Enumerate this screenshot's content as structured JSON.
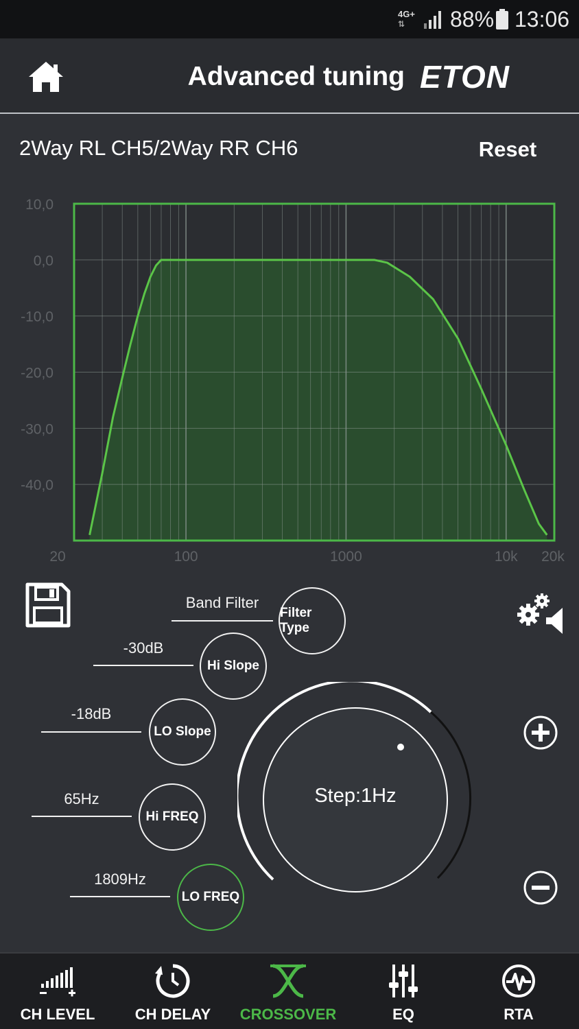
{
  "status_bar": {
    "network": "4G+",
    "battery": "88%",
    "time": "13:06"
  },
  "header": {
    "title": "Advanced tuning",
    "brand": "ETON"
  },
  "channel": {
    "title": "2Way RL CH5/2Way RR CH6",
    "reset_label": "Reset"
  },
  "chart_data": {
    "type": "area",
    "y_axis": {
      "range": [
        -50,
        10
      ],
      "tick_labels": [
        "10,0",
        "0,0",
        "-10,0",
        "-20,0",
        "-30,0",
        "-40,0"
      ],
      "ticks": [
        10,
        0,
        -10,
        -20,
        -30,
        -40
      ]
    },
    "x_axis": {
      "scale": "log",
      "range": [
        20,
        20000
      ],
      "tick_labels": [
        "20",
        "100",
        "1000",
        "10k",
        "20k"
      ],
      "ticks": [
        20,
        100,
        1000,
        10000,
        20000
      ]
    },
    "grid": true,
    "series": [
      {
        "x": [
          25,
          30,
          35,
          40,
          45,
          50,
          55,
          60,
          65,
          70,
          80,
          90,
          100,
          200,
          500,
          1000,
          1200,
          1500,
          1809,
          2500,
          3500,
          5000,
          7000,
          10000,
          13000,
          16000,
          18000
        ],
        "y": [
          -49,
          -38,
          -28,
          -21,
          -15,
          -10,
          -6,
          -3,
          -1,
          0,
          0,
          0,
          0,
          0,
          0,
          0,
          0,
          0,
          -0.5,
          -3,
          -7,
          -14,
          -23,
          -33,
          -41,
          -47,
          -49
        ]
      }
    ],
    "colors": {
      "fill": "#2a4d2e",
      "line": "#5bc548",
      "border": "#4cb848",
      "grid": "#8a9690",
      "tick_label": "#5f6266"
    }
  },
  "crossover": {
    "filter_type": {
      "value": "Band Filter",
      "label": "Filter Type"
    },
    "hi_slope": {
      "value": "-30dB",
      "label": "Hi Slope"
    },
    "lo_slope": {
      "value": "-18dB",
      "label": "LO Slope"
    },
    "hi_freq": {
      "value": "65Hz",
      "label": "Hi FREQ"
    },
    "lo_freq": {
      "value": "1809Hz",
      "label": "LO FREQ"
    },
    "knob": {
      "label": "Step:1Hz"
    }
  },
  "icons": {
    "save": "save-icon",
    "settings": "settings-speaker-icon",
    "plus": "plus-icon",
    "minus": "minus-icon"
  },
  "nav": [
    {
      "label": "CH LEVEL",
      "icon": "ch-level-icon"
    },
    {
      "label": "CH DELAY",
      "icon": "ch-delay-icon"
    },
    {
      "label": "CROSSOVER",
      "icon": "crossover-icon"
    },
    {
      "label": "EQ",
      "icon": "eq-icon"
    },
    {
      "label": "RTA",
      "icon": "rta-icon"
    }
  ],
  "colors": {
    "accent": "#4cb848",
    "background": "#2f3136",
    "header": "#2a2c30",
    "statusbar": "#111214",
    "nav": "#1d1e21"
  }
}
